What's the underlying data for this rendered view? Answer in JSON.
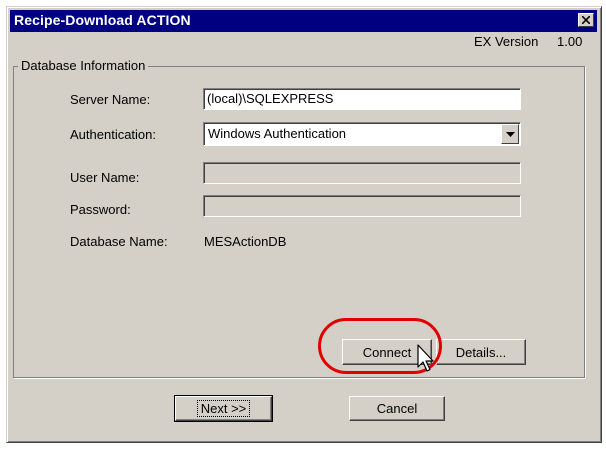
{
  "window": {
    "title": "Recipe-Download ACTION"
  },
  "version": {
    "label": "EX Version",
    "number": "1.00"
  },
  "group": {
    "title": "Database Information"
  },
  "form": {
    "server_label": "Server Name:",
    "server_value": "(local)\\SQLEXPRESS",
    "auth_label": "Authentication:",
    "auth_value": "Windows Authentication",
    "user_label": "User Name:",
    "user_value": "",
    "password_label": "Password:",
    "password_value": "",
    "dbname_label": "Database Name:",
    "dbname_value": "MESActionDB"
  },
  "buttons": {
    "connect": "Connect",
    "details": "Details...",
    "next": "Next >>",
    "cancel": "Cancel"
  },
  "icons": {
    "close": "close-icon",
    "dropdown": "chevron-down-icon",
    "cursor": "mouse-pointer-icon"
  },
  "colors": {
    "titlebar": "#000080",
    "dialog_face": "#d4d0c8",
    "highlight_ring": "#e00000"
  }
}
